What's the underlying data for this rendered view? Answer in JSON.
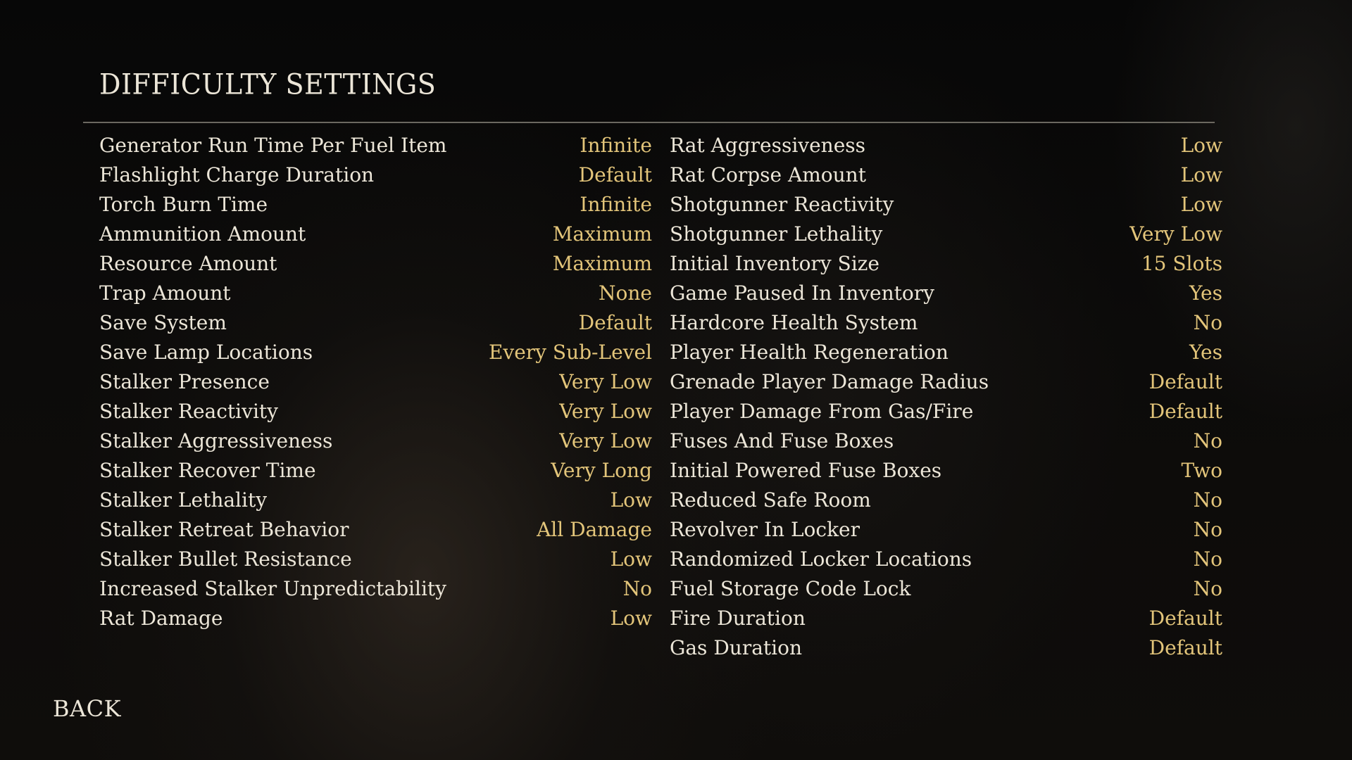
{
  "title": "DIFFICULTY SETTINGS",
  "back_label": "BACK",
  "colors": {
    "label": "#ece6d8",
    "value": "#e3c57a",
    "divider": "#6b6860"
  },
  "left_settings": [
    {
      "label": "Generator Run Time Per Fuel Item",
      "value": "Infinite"
    },
    {
      "label": "Flashlight Charge Duration",
      "value": "Default"
    },
    {
      "label": "Torch Burn Time",
      "value": "Infinite"
    },
    {
      "label": "Ammunition Amount",
      "value": "Maximum"
    },
    {
      "label": "Resource Amount",
      "value": "Maximum"
    },
    {
      "label": "Trap Amount",
      "value": "None"
    },
    {
      "label": "Save System",
      "value": "Default"
    },
    {
      "label": "Save Lamp Locations",
      "value": "Every Sub-Level"
    },
    {
      "label": "Stalker Presence",
      "value": "Very Low"
    },
    {
      "label": "Stalker Reactivity",
      "value": "Very Low"
    },
    {
      "label": "Stalker Aggressiveness",
      "value": "Very Low"
    },
    {
      "label": "Stalker Recover Time",
      "value": "Very Long"
    },
    {
      "label": "Stalker Lethality",
      "value": "Low"
    },
    {
      "label": "Stalker Retreat Behavior",
      "value": "All Damage"
    },
    {
      "label": "Stalker Bullet Resistance",
      "value": "Low"
    },
    {
      "label": "Increased Stalker Unpredictability",
      "value": "No"
    },
    {
      "label": "Rat Damage",
      "value": "Low"
    }
  ],
  "right_settings": [
    {
      "label": "Rat Aggressiveness",
      "value": "Low"
    },
    {
      "label": "Rat Corpse Amount",
      "value": "Low"
    },
    {
      "label": "Shotgunner Reactivity",
      "value": "Low"
    },
    {
      "label": "Shotgunner Lethality",
      "value": "Very Low"
    },
    {
      "label": "Initial Inventory Size",
      "value": "15 Slots"
    },
    {
      "label": "Game Paused In Inventory",
      "value": "Yes"
    },
    {
      "label": "Hardcore Health System",
      "value": "No"
    },
    {
      "label": "Player Health Regeneration",
      "value": "Yes"
    },
    {
      "label": "Grenade Player Damage Radius",
      "value": "Default"
    },
    {
      "label": "Player Damage From Gas/Fire",
      "value": "Default"
    },
    {
      "label": "Fuses And Fuse Boxes",
      "value": "No"
    },
    {
      "label": "Initial Powered Fuse Boxes",
      "value": "Two"
    },
    {
      "label": "Reduced Safe Room",
      "value": "No"
    },
    {
      "label": "Revolver In Locker",
      "value": "No"
    },
    {
      "label": "Randomized Locker Locations",
      "value": "No"
    },
    {
      "label": "Fuel Storage Code Lock",
      "value": "No"
    },
    {
      "label": "Fire Duration",
      "value": "Default"
    },
    {
      "label": "Gas Duration",
      "value": "Default"
    }
  ]
}
